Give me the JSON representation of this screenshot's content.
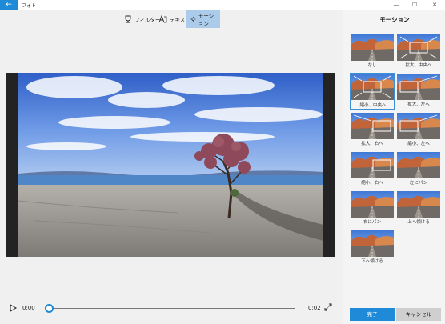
{
  "window": {
    "back_icon": "back-arrow-icon",
    "title": "フォト",
    "minimize": "—",
    "maximize": "☐",
    "close": "✕"
  },
  "toolbar": {
    "filter_label": "フィルター",
    "text_label": "テキスト",
    "motion_label": "モーション"
  },
  "player": {
    "current_time": "0:00",
    "end_time": "0:02",
    "progress": 0
  },
  "panel": {
    "title": "モーション",
    "selected": "縮小、中央へ",
    "options": [
      {
        "label": "なし"
      },
      {
        "label": "拡大、中央へ"
      },
      {
        "label": "縮小、中央へ"
      },
      {
        "label": "拡大、左へ"
      },
      {
        "label": "拡大、右へ"
      },
      {
        "label": "縮小、左へ"
      },
      {
        "label": "縮小、右へ"
      },
      {
        "label": "左にパン"
      },
      {
        "label": "右にパン"
      },
      {
        "label": "上へ傾ける"
      },
      {
        "label": "下へ傾ける"
      }
    ],
    "done_label": "完了",
    "cancel_label": "キャンセル"
  },
  "colors": {
    "accent": "#1f8ad7",
    "active_tab": "#aacbe9"
  }
}
